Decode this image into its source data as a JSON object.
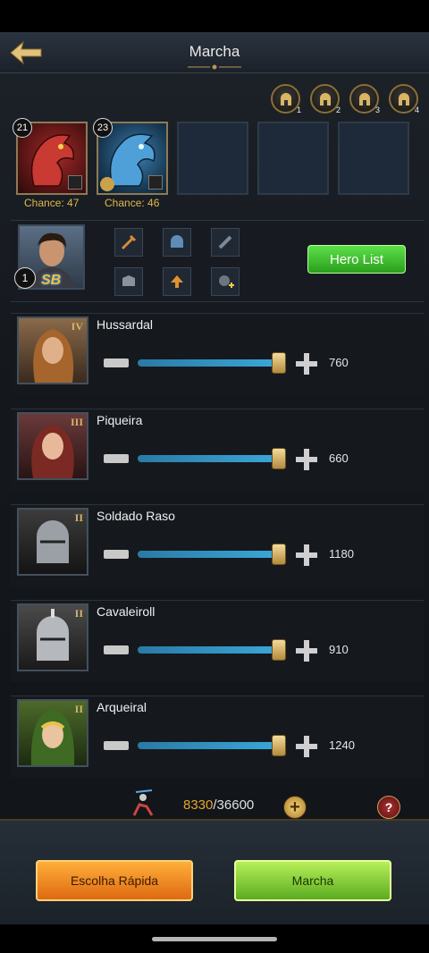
{
  "header": {
    "title": "Marcha"
  },
  "formations": [
    {
      "num": "1"
    },
    {
      "num": "2"
    },
    {
      "num": "3"
    },
    {
      "num": "4"
    }
  ],
  "dragons": [
    {
      "level": "21",
      "chance": "Chance: 47"
    },
    {
      "level": "23",
      "chance": "Chance: 46"
    }
  ],
  "hero": {
    "level": "1",
    "tag": "SB",
    "list_button": "Hero List"
  },
  "troops": [
    {
      "name": "Hussardal",
      "tier": "IV",
      "count": "760",
      "fill": 1.0
    },
    {
      "name": "Piqueira",
      "tier": "III",
      "count": "660",
      "fill": 1.0
    },
    {
      "name": "Soldado Raso",
      "tier": "II",
      "count": "1180",
      "fill": 1.0
    },
    {
      "name": "Cavaleiroll",
      "tier": "II",
      "count": "910",
      "fill": 1.0
    },
    {
      "name": "Arqueiral",
      "tier": "II",
      "count": "1240",
      "fill": 1.0
    }
  ],
  "capacity": {
    "current": "8330",
    "max": "/36600"
  },
  "footer": {
    "quick_label": "Escolha Rápida",
    "march_label": "Marcha"
  },
  "colors": {
    "accent_gold": "#e1b84a",
    "green_button": "#3cc02a",
    "orange_button": "#f08a20"
  }
}
